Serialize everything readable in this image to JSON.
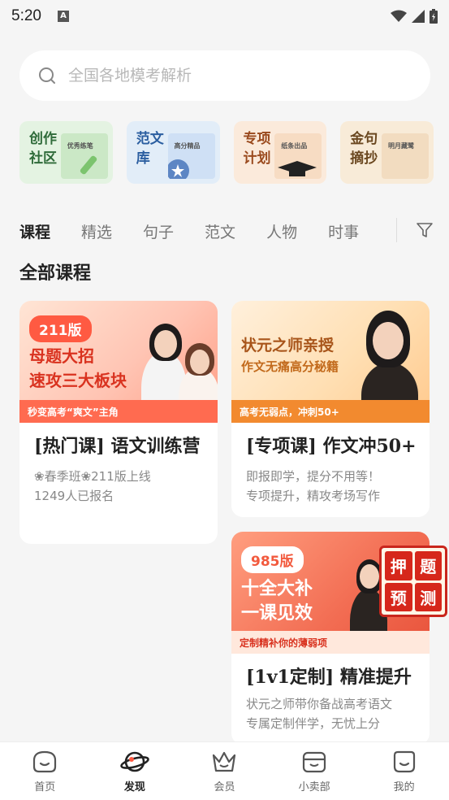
{
  "status_bar": {
    "time": "5:20",
    "notification_letter": "A"
  },
  "search": {
    "placeholder": "全国各地模考解析"
  },
  "quick_entries": [
    {
      "title": "创作\n社区",
      "deco_text": "优秀练笔"
    },
    {
      "title": "范文\n库",
      "deco_text": "高分精品"
    },
    {
      "title": "专项\n计划",
      "deco_text": "纸条出品"
    },
    {
      "title": "金句\n摘抄",
      "deco_text": "明月藏鹭"
    }
  ],
  "tabs": [
    "课程",
    "精选",
    "句子",
    "范文",
    "人物",
    "时事"
  ],
  "section_title": "全部课程",
  "courses": [
    {
      "badge": "211版",
      "headline1": "母题大招",
      "headline2": "速攻三大板块",
      "strip": "秒变高考“爽文”主角",
      "title": "[热门课] 语文训练营",
      "line1": "❀春季班❀211版上线",
      "line2": "1249人已报名"
    },
    {
      "badge": "",
      "headline1": "状元之师亲授",
      "headline2": "作文无痛高分秘籍",
      "strip": "高考无弱点，冲刺50+",
      "title": "[专项课] 作文冲50+",
      "line1": "即报即学，提分不用等！",
      "line2": "专项提升，精攻考场写作"
    },
    {
      "badge": "985版",
      "headline1": "十全大补",
      "headline2": "一课见效",
      "strip": "定制精补你的薄弱项",
      "title": "[1v1定制] 精准提升",
      "line1": "状元之师带你备战高考语文",
      "line2": "专属定制伴学，无忧上分"
    }
  ],
  "stamp": [
    "押",
    "题",
    "预",
    "测"
  ],
  "bottom_nav": [
    {
      "label": "首页",
      "icon": "home-face-icon"
    },
    {
      "label": "发现",
      "icon": "planet-icon"
    },
    {
      "label": "会员",
      "icon": "crown-icon"
    },
    {
      "label": "小卖部",
      "icon": "shop-icon"
    },
    {
      "label": "我的",
      "icon": "profile-face-icon"
    }
  ],
  "colors": {
    "accent": "#ff5a42",
    "active_text": "#222222",
    "inactive_text": "#777777"
  }
}
